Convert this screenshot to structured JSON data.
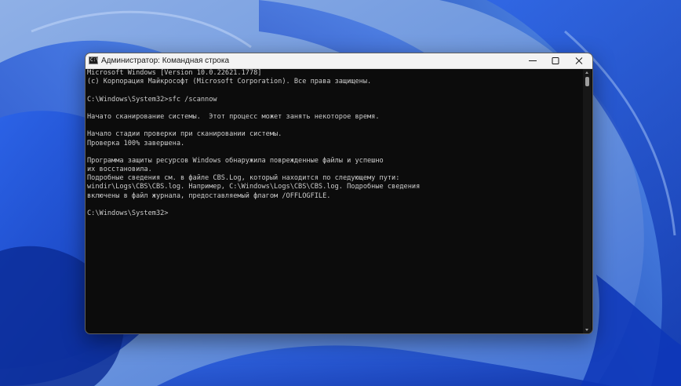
{
  "window": {
    "title": "Администратор: Командная строка",
    "icon": "cmd-icon",
    "icon_glyph": "C:\\"
  },
  "controls": {
    "minimize_icon": "minimize-icon",
    "maximize_icon": "maximize-icon",
    "close_icon": "close-icon"
  },
  "console": {
    "lines": [
      "Microsoft Windows [Version 10.0.22621.1778]",
      "(c) Корпорация Майкрософт (Microsoft Corporation). Все права защищены.",
      "",
      "C:\\Windows\\System32>sfc /scannow",
      "",
      "Начато сканирование системы.  Этот процесс может занять некоторое время.",
      "",
      "Начало стадии проверки при сканировании системы.",
      "Проверка 100% завершена.",
      "",
      "Программа защиты ресурсов Windows обнаружила поврежденные файлы и успешно",
      "их восстановила.",
      "Подробные сведения см. в файле CBS.Log, который находится по следующему пути:",
      "windir\\Logs\\CBS\\CBS.log. Например, C:\\Windows\\Logs\\CBS\\CBS.log. Подробные сведения",
      "включены в файл журнала, предоставляемый флагом /OFFLOGFILE.",
      "",
      "C:\\Windows\\System32>"
    ],
    "text_color": "#cccccc",
    "background": "#0c0c0c"
  },
  "colors": {
    "titlebar": "#f3f3f3",
    "wallpaper_base": "#5a86d8",
    "wallpaper_accent": "#1f4fd0"
  }
}
